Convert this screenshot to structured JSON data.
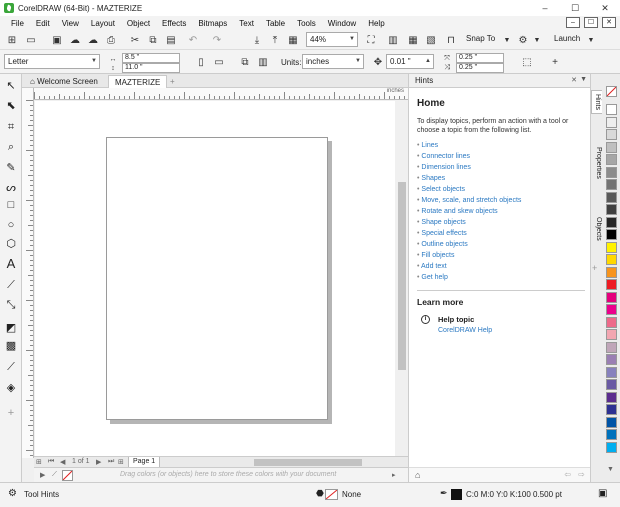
{
  "window": {
    "title": "CorelDRAW (64-Bit) - MAZTERIZE",
    "minimize": "–",
    "maximize": "☐",
    "close": "✕"
  },
  "menu": [
    "File",
    "Edit",
    "View",
    "Layout",
    "Object",
    "Effects",
    "Bitmaps",
    "Text",
    "Table",
    "Tools",
    "Window",
    "Help"
  ],
  "menu_controls": [
    "–",
    "☐",
    "✕"
  ],
  "toolbar": {
    "zoom": "44%",
    "snap_to": "Snap To",
    "launch": "Launch"
  },
  "property_bar": {
    "page_size": "Letter",
    "width": "8.5 \"",
    "height": "11.0 \"",
    "units_label": "Units:",
    "units": "inches",
    "nudge": "0.01 \"",
    "dup_x": "0.25 \"",
    "dup_y": "0.25 \""
  },
  "doc_tabs": [
    "Welcome Screen",
    "MAZTERIZE"
  ],
  "ruler_unit": "inches",
  "page_nav": {
    "counter": "1 of 1",
    "page_tab": "Page 1"
  },
  "palette_hint": "Drag colors (or objects) here to store these colors with your document",
  "hints": {
    "panel_title": "Hints",
    "heading": "Home",
    "intro": "To display topics, perform an action with a tool or choose a topic from the following list.",
    "topics": [
      "Lines",
      "Connector lines",
      "Dimension lines",
      "Shapes",
      "Select objects",
      "Move, scale, and stretch objects",
      "Rotate and skew objects",
      "Shape objects",
      "Special effects",
      "Outline objects",
      "Fill objects",
      "Add text",
      "Get help"
    ],
    "learn_more": "Learn more",
    "help_topic": "Help topic",
    "help_link": "CorelDRAW Help"
  },
  "side_tabs": [
    "Hints",
    "Properties",
    "Objects"
  ],
  "palette_colors": [
    "#ffffff",
    "#eeeeee",
    "#d9d9d9",
    "#bfbfbf",
    "#a6a6a6",
    "#8c8c8c",
    "#737373",
    "#595959",
    "#404040",
    "#262626",
    "#000000",
    "#fff200",
    "#ffd800",
    "#f7941d",
    "#ed1c24",
    "#e4007c",
    "#ec008c",
    "#ed6a8a",
    "#f2a6b1",
    "#c0a6b9",
    "#9a7fb3",
    "#8781bd",
    "#6a5aa3",
    "#5b2c8e",
    "#2e3192",
    "#0054a6",
    "#0072bc",
    "#00aeef"
  ],
  "status": {
    "tool_hints": "Tool Hints",
    "fill_none": "None",
    "outline": "C:0 M:0 Y:0 K:100  0.500 pt"
  }
}
